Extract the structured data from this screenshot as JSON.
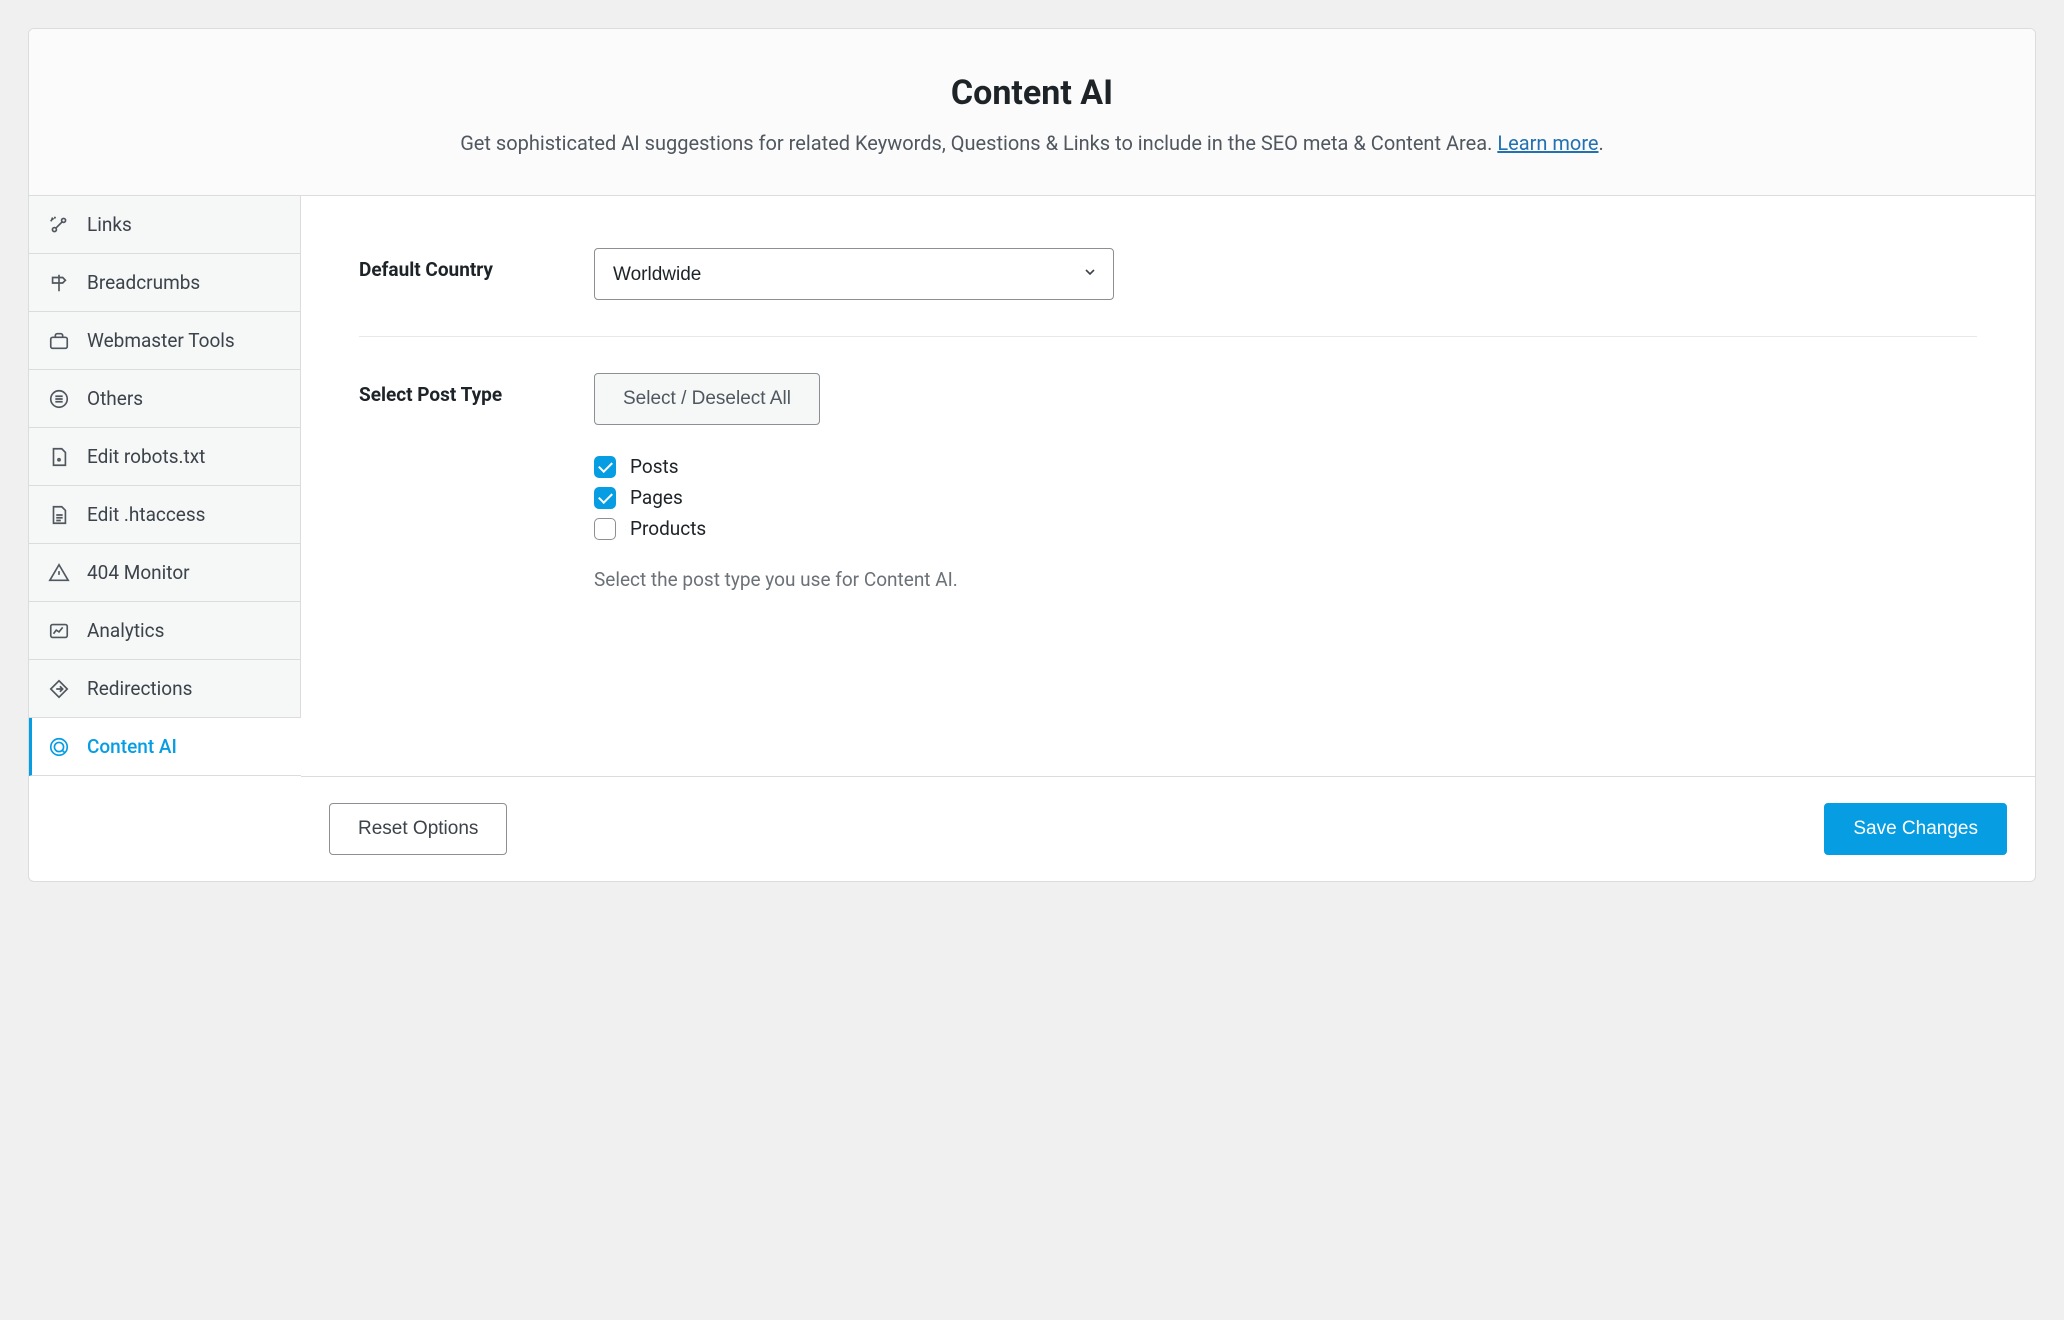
{
  "header": {
    "title": "Content AI",
    "description": "Get sophisticated AI suggestions for related Keywords, Questions & Links to include in the SEO meta & Content Area. ",
    "learn_more": "Learn more"
  },
  "sidebar": {
    "items": [
      {
        "label": "Links",
        "icon": "links-icon",
        "active": false
      },
      {
        "label": "Breadcrumbs",
        "icon": "signpost-icon",
        "active": false
      },
      {
        "label": "Webmaster Tools",
        "icon": "briefcase-icon",
        "active": false
      },
      {
        "label": "Others",
        "icon": "list-circle-icon",
        "active": false
      },
      {
        "label": "Edit robots.txt",
        "icon": "file-robot-icon",
        "active": false
      },
      {
        "label": "Edit .htaccess",
        "icon": "file-lines-icon",
        "active": false
      },
      {
        "label": "404 Monitor",
        "icon": "warning-icon",
        "active": false
      },
      {
        "label": "Analytics",
        "icon": "chart-icon",
        "active": false
      },
      {
        "label": "Redirections",
        "icon": "redirect-icon",
        "active": false
      },
      {
        "label": "Content AI",
        "icon": "target-icon",
        "active": true
      }
    ]
  },
  "form": {
    "default_country": {
      "label": "Default Country",
      "value": "Worldwide"
    },
    "post_type": {
      "label": "Select Post Type",
      "toggle_button": "Select / Deselect All",
      "options": [
        {
          "label": "Posts",
          "checked": true
        },
        {
          "label": "Pages",
          "checked": true
        },
        {
          "label": "Products",
          "checked": false
        }
      ],
      "help": "Select the post type you use for Content AI."
    }
  },
  "footer": {
    "reset": "Reset Options",
    "save": "Save Changes"
  }
}
